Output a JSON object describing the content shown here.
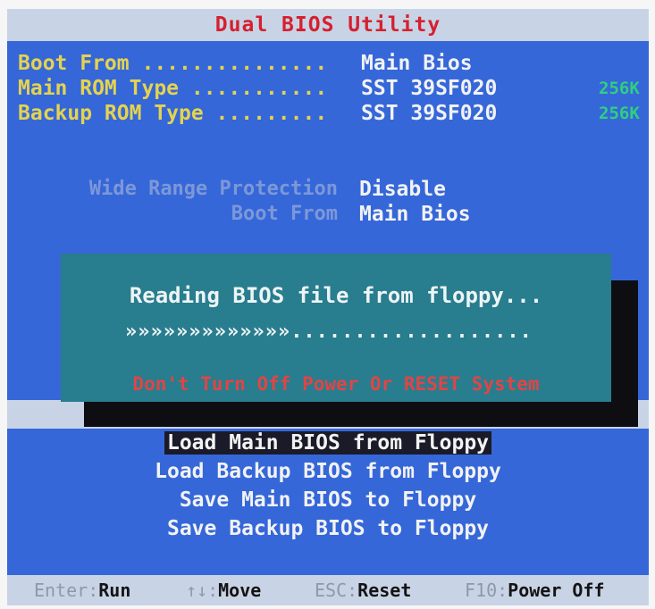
{
  "title": "Dual BIOS Utility",
  "info": [
    {
      "label": "Boot From ...............",
      "value": "Main Bios",
      "size": ""
    },
    {
      "label": "Main ROM Type ...........",
      "value": "SST 39SF020",
      "size": "256K"
    },
    {
      "label": "Backup ROM Type .........",
      "value": "SST 39SF020",
      "size": "256K"
    }
  ],
  "settings": [
    {
      "label": "Wide Range Protection",
      "value": "Disable"
    },
    {
      "label": "Boot From",
      "value": "Main Bios"
    }
  ],
  "dialog": {
    "message": "Reading BIOS file from floppy...",
    "progress_done": "»»»»»»»»»»»»»",
    "progress_remaining": "...................",
    "warning": "Don't Turn Off Power Or RESET System"
  },
  "menu": [
    {
      "label": "Load Main BIOS from Floppy",
      "selected": true
    },
    {
      "label": "Load Backup BIOS from Floppy",
      "selected": false
    },
    {
      "label": "Save Main BIOS to Floppy",
      "selected": false
    },
    {
      "label": "Save Backup BIOS to Floppy",
      "selected": false
    }
  ],
  "status": [
    {
      "key": "Enter",
      "action": "Run"
    },
    {
      "key": "↑↓",
      "action": "Move"
    },
    {
      "key": "ESC",
      "action": "Reset"
    },
    {
      "key": "F10",
      "action": "Power Off"
    }
  ],
  "colors": {
    "screen_bg": "#3567d9",
    "title_text": "#d6202f",
    "label_yellow": "#e4d34f",
    "size_green": "#2fcf7f",
    "dialog_bg": "#287d8f",
    "warning_red": "#e04545"
  }
}
